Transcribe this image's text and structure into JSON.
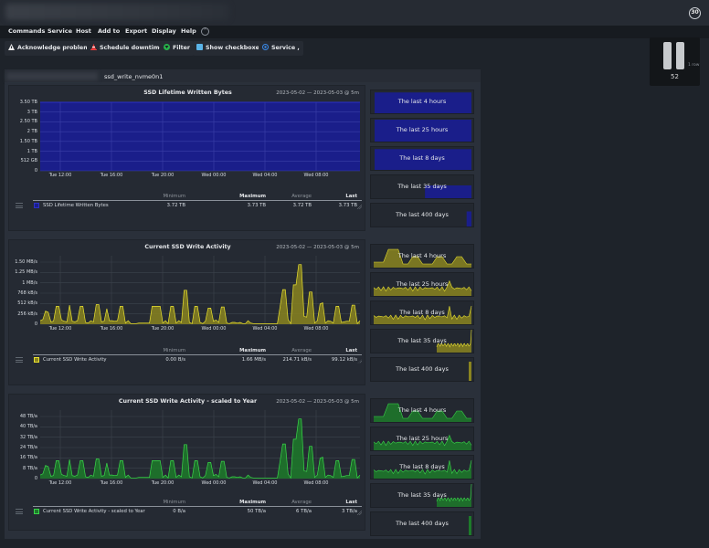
{
  "titlebar": {
    "refresh_seconds": "30"
  },
  "menu": [
    "Commands",
    "Service",
    "Host",
    "Add to",
    "Export",
    "Display",
    "Help"
  ],
  "toolbar": [
    {
      "label": "Acknowledge problems",
      "icon": "warning-icon"
    },
    {
      "label": "Schedule downtimes",
      "icon": "cone-icon"
    },
    {
      "label": "Filter",
      "icon": "filter-icon"
    },
    {
      "label": "Show checkboxes",
      "icon": "checkbox-icon"
    },
    {
      "label": "Service ,",
      "icon": "service-icon"
    }
  ],
  "perf": {
    "value": "52",
    "row_label": "1 row"
  },
  "service": {
    "name": "ssd_write_nvme0n1"
  },
  "timeframes": [
    "The last 4 hours",
    "The last 25 hours",
    "The last 8 days",
    "The last 35 days",
    "The last 400 days"
  ],
  "legend_headers": {
    "min": "Minimum",
    "max": "Maximum",
    "avg": "Average",
    "last": "Last"
  },
  "graphs": [
    {
      "title": "SSD Lifetime Written Bytes",
      "range": "2023-05-02 — 2023-05-03 @ 5m",
      "color": "#1a1e8a",
      "line": "#2b30c8",
      "yticks": [
        "3.50 TB",
        "3 TB",
        "2.50 TB",
        "2 TB",
        "1.50 TB",
        "1 TB",
        "512 GB",
        "0"
      ],
      "xticks": [
        "Tue 12:00",
        "Tue 16:00",
        "Tue 20:00",
        "Wed 00:00",
        "Wed 04:00",
        "Wed 08:00"
      ],
      "legend": {
        "name": "SSD Lifetime Written Bytes",
        "min": "3.72 TB",
        "max": "3.73 TB",
        "avg": "3.72 TB",
        "last": "3.73 TB"
      }
    },
    {
      "title": "Current SSD Write Activity",
      "range": "2023-05-02 — 2023-05-03 @ 5m",
      "color": "#8a8420",
      "line": "#e8e030",
      "yticks": [
        "1.50 MB/s",
        "1.25 MB/s",
        "1 MB/s",
        "768 kB/s",
        "512 kB/s",
        "256 kB/s",
        "0"
      ],
      "xticks": [
        "Tue 12:00",
        "Tue 16:00",
        "Tue 20:00",
        "Wed 00:00",
        "Wed 04:00",
        "Wed 08:00"
      ],
      "legend": {
        "name": "Current SSD Write Activity",
        "min": "0.00 B/s",
        "max": "1.66 MB/s",
        "avg": "214.71 kB/s",
        "last": "99.12 kB/s"
      }
    },
    {
      "title": "Current SSD Write Activity - scaled to Year",
      "range": "2023-05-02 — 2023-05-03 @ 5m",
      "color": "#1d7a2a",
      "line": "#3ad64a",
      "yticks": [
        "48 TB/a",
        "40 TB/a",
        "32 TB/a",
        "24 TB/a",
        "16 TB/a",
        "8 TB/a",
        "0"
      ],
      "xticks": [
        "Tue 12:00",
        "Tue 16:00",
        "Tue 20:00",
        "Wed 00:00",
        "Wed 04:00",
        "Wed 08:00"
      ],
      "legend": {
        "name": "Current SSD Write Activity - scaled to Year",
        "min": "0 B/a",
        "max": "50 TB/a",
        "avg": "6 TB/a",
        "last": "3 TB/a"
      }
    }
  ],
  "activity_series": [
    0.06,
    0.08,
    0.22,
    0.2,
    0.04,
    0.05,
    0.3,
    0.3,
    0.07,
    0.05,
    0.04,
    0.32,
    0.05,
    0.04,
    0.06,
    0.3,
    0.3,
    0.03,
    0.02,
    0.06,
    0.04,
    0.33,
    0.33,
    0.04,
    0.05,
    0.26,
    0.06,
    0.06,
    0.05,
    0.06,
    0.3,
    0.3,
    0.02,
    0.06,
    0.01,
    0.01,
    0.01,
    0.02,
    0.02,
    0.02,
    0.02,
    0.02,
    0.3,
    0.3,
    0.3,
    0.3,
    0.02,
    0.06,
    0.01,
    0.3,
    0.3,
    0.02,
    0.06,
    0.03,
    0.57,
    0.57,
    0.03,
    0.01,
    0.3,
    0.3,
    0.03,
    0.01,
    0.05,
    0.27,
    0.27,
    0.05,
    0.07,
    0.03,
    0.29,
    0.29,
    0.02,
    0.01,
    0.03,
    0.03,
    0.02,
    0.03,
    0.01,
    0.01,
    0.06,
    0.02,
    0.01,
    0.01,
    0.01,
    0.01,
    0.01,
    0.01,
    0.01,
    0.01,
    0.01,
    0.01,
    0.29,
    0.58,
    0.58,
    0.08,
    0.01,
    0.66,
    0.66,
    1.0,
    1.0,
    0.13,
    0.12,
    0.54,
    0.54,
    0.02,
    0.06,
    0.34,
    0.36,
    0.02,
    0.06,
    0.05,
    0.02,
    0.3,
    0.3,
    0.03,
    0.04,
    0.05,
    0.05,
    0.32,
    0.32,
    0.01,
    0.06
  ]
}
